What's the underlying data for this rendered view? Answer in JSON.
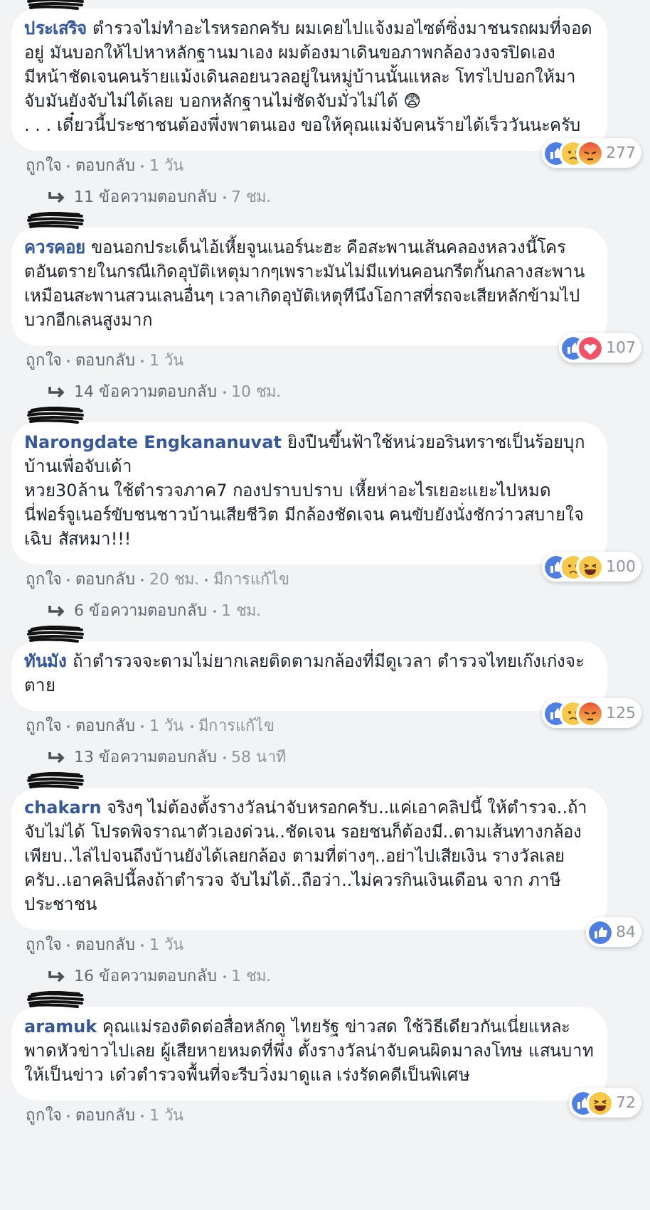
{
  "comments": [
    {
      "name": "ประเสริจ",
      "text": "ตำรวจไม่ทำอะไรหรอกครับ ผมเคยไปแจ้งมอไซต์ซิ่งมาชนรถผมที่จอดอยู่ มันบอกให้ไปหาหลักฐานมาเอง ผมต้องมาเดินขอภาพกล้องวงจรปิดเอง มีหน้าชัดเจนคนร้ายแม้งเดินลอยนวลอยู่ในหมู่บ้านนั้นแหละ โทรไปบอกให้มาจับมันยังจับไม่ได้เลย บอกหลักฐานไม่ชัดจับมั่วไม่ได้ 😨\n. . . เดี๋ยวนี้ประชาชนต้องพึ่งพาตนเอง ขอให้คุณแม่จับคนร้ายได้เร็ววันนะครับ",
      "reactions": [
        {
          "kind": "like"
        },
        {
          "kind": "sad"
        },
        {
          "kind": "angry"
        }
      ],
      "reaction_count": "277",
      "actions": [
        "ถูกใจ",
        "ตอบกลับ"
      ],
      "time": "1 วัน",
      "replies": {
        "label": "11 ข้อความตอบกลับ",
        "time": "7 ชม."
      }
    },
    {
      "name": "ควรคอย",
      "text": "ขอนอกประเด็นไอ้เหี้ยจูนเนอร์นะฮะ คือสะพานเส้นคลองหลวงนี้โครตอันตรายในกรณีเกิดอุบัติเหตุมากๆเพราะมันไม่มีแท่นคอนกรีตกั้นกลางสะพานเหมือนสะพานสวนเลนอื่นๆ เวลาเกิดอุบัติเหตุทีนึงโอกาสที่รถจะเสียหลักข้ามไปบวกอีกเลนสูงมาก",
      "reactions": [
        {
          "kind": "like"
        },
        {
          "kind": "love"
        }
      ],
      "reaction_count": "107",
      "actions": [
        "ถูกใจ",
        "ตอบกลับ"
      ],
      "time": "1 วัน",
      "replies": {
        "label": "14 ข้อความตอบกลับ",
        "time": "10 ชม."
      }
    },
    {
      "name": "Narongdate Engkananuvat",
      "text": "ยิงปืนขึ้นฟ้าใช้หน่วยอรินทราชเป็นร้อยบุกบ้านเพื่อจับเด้า\nหวย30ล้าน ใช้ตำรวจภาค7 กองปราบปราบ เหี้ยห่าอะไรเยอะแยะไปหมด\nนี่ฟอร์จูเนอร์ขับชนชาวบ้านเสียชีวิต มีกล้องชัดเจน คนขับยังนั่งชักว่าวสบายใจเฉิบ สัสหมา!!!",
      "reactions": [
        {
          "kind": "like"
        },
        {
          "kind": "sad"
        },
        {
          "kind": "haha"
        }
      ],
      "reaction_count": "100",
      "actions": [
        "ถูกใจ",
        "ตอบกลับ"
      ],
      "time": "20 ชม.",
      "edited": "มีการแก้ไข",
      "replies": {
        "label": "6 ข้อความตอบกลับ",
        "time": "1 ชม."
      }
    },
    {
      "name": "ทันมัง",
      "text": "ถ้าตำรวจจะตามไม่ยากเลยติดตามกล้องที่มีดูเวลา ตำรวจไทยเก๊งเก่งจะตาย",
      "reactions": [
        {
          "kind": "like"
        },
        {
          "kind": "sad"
        },
        {
          "kind": "angry"
        }
      ],
      "reaction_count": "125",
      "actions": [
        "ถูกใจ",
        "ตอบกลับ"
      ],
      "time": "1 วัน",
      "edited": "มีการแก้ไข",
      "replies": {
        "label": "13 ข้อความตอบกลับ",
        "time": "58 นาที"
      }
    },
    {
      "name": "chakarn",
      "text": "จริงๆ ไม่ต้องตั้งรางวัลน่าจับหรอกครับ..แค่เอาคลิปนี้ ให้ตำรวจ..ถ้าจับไม่ได้ โปรดพิจราณาตัวเองด่วน..ชัดเจน รอยชนก็ต้องมี..ตามเส้นทางกล้องเพียบ..ไล่ไปจนถึงบ้านยังได้เลยกล้อง ตามที่ต่างๆ..อย่าไปเสียเงิน รางวัลเลยครับ..เอาคลิปนี้ลงถ้าตำรวจ จับไม่ได้..ถือว่า..ไม่ควรกินเงินเดือน จาก ภาษี ประชาชน",
      "reactions": [
        {
          "kind": "like"
        }
      ],
      "reaction_count": "84",
      "actions": [
        "ถูกใจ",
        "ตอบกลับ"
      ],
      "time": "1 วัน",
      "replies": {
        "label": "16 ข้อความตอบกลับ",
        "time": "1 ชม."
      }
    },
    {
      "name": "aramuk",
      "text": "คุณแม่รองติดต่อสื่อหลักดู ไทยรัฐ ข่าวสด ใช้วิธีเดียวกันเนี่ยแหละ\nพาดหัวข่าวไปเลย ผู้เสียหายหมดที่พึ่ง ตั้งรางวัลน่าจับคนผิดมาลงโทษ แสนบาท ให้เป็นข่าว เด๋วตำรวจพื้นที่จะรีบวิ่งมาดูแล เร่งรัดคดีเป็นพิเศษ",
      "reactions": [
        {
          "kind": "like"
        },
        {
          "kind": "haha"
        }
      ],
      "reaction_count": "72",
      "actions": [
        "ถูกใจ",
        "ตอบกลับ"
      ],
      "time": "1 วัน"
    }
  ]
}
